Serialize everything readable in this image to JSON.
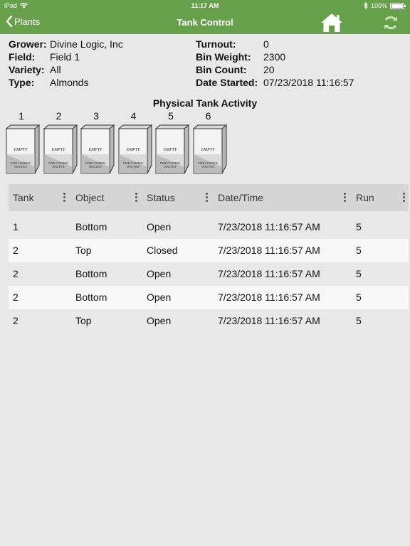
{
  "status_bar": {
    "device": "iPad",
    "time": "11:17 AM",
    "battery": "100%"
  },
  "nav": {
    "back_label": "Plants",
    "title": "Tank Control"
  },
  "info": {
    "left": [
      {
        "label": "Grower:",
        "value": "Divine Logic, Inc"
      },
      {
        "label": "Field:",
        "value": "Field 1"
      },
      {
        "label": "Variety:",
        "value": "All"
      },
      {
        "label": "Type:",
        "value": "Almonds"
      }
    ],
    "right": [
      {
        "label": "Turnout:",
        "value": "0"
      },
      {
        "label": "Bin Weight:",
        "value": "2300"
      },
      {
        "label": "Bin Count:",
        "value": "20"
      },
      {
        "label": "Date Started:",
        "value": "07/23/2018 11:16:57"
      }
    ]
  },
  "activity": {
    "title": "Physical Tank Activity",
    "tanks": [
      {
        "number": "1",
        "state": "EMPTY",
        "control": "TANK CONTROL",
        "control_state": "INACTIVE"
      },
      {
        "number": "2",
        "state": "EMPTY",
        "control": "TANK CONTROL",
        "control_state": "INACTIVE"
      },
      {
        "number": "3",
        "state": "EMPTY",
        "control": "TANK CONTROL",
        "control_state": "INACTIVE"
      },
      {
        "number": "4",
        "state": "EMPTY",
        "control": "TANK CONTROL",
        "control_state": "INACTIVE"
      },
      {
        "number": "5",
        "state": "EMPTY",
        "control": "TANK CONTROL",
        "control_state": "INACTIVE"
      },
      {
        "number": "6",
        "state": "EMPTY",
        "control": "TANK CONTROL",
        "control_state": "INACTIVE"
      }
    ]
  },
  "table": {
    "columns": [
      "Tank",
      "Object",
      "Status",
      "Date/Time",
      "Run"
    ],
    "rows": [
      [
        "1",
        "Bottom",
        "Open",
        "7/23/2018 11:16:57 AM",
        "5"
      ],
      [
        "2",
        "Top",
        "Closed",
        "7/23/2018 11:16:57 AM",
        "5"
      ],
      [
        "2",
        "Bottom",
        "Open",
        "7/23/2018 11:16:57 AM",
        "5"
      ],
      [
        "2",
        "Bottom",
        "Open",
        "7/23/2018 11:16:57 AM",
        "5"
      ],
      [
        "2",
        "Top",
        "Open",
        "7/23/2018 11:16:57 AM",
        "5"
      ]
    ]
  },
  "colors": {
    "brand": "#67a04a",
    "header_row": "#d6d6d6",
    "background": "#e8e8e8"
  }
}
